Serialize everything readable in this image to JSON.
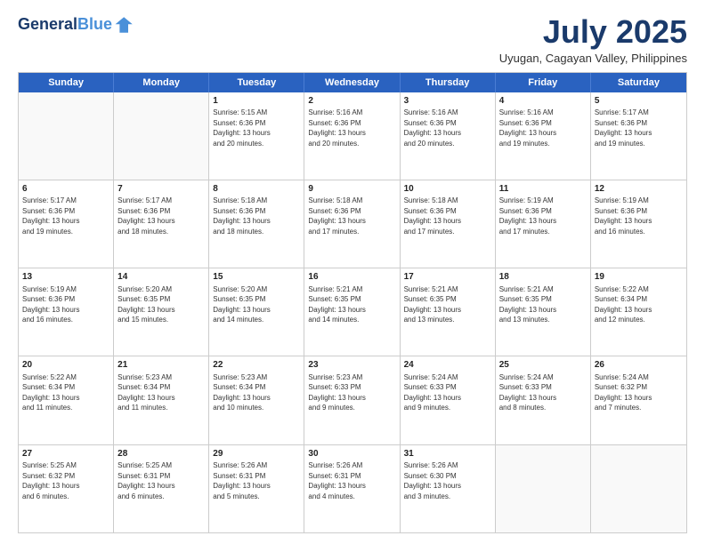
{
  "header": {
    "logo_line1": "General",
    "logo_line2": "Blue",
    "month": "July 2025",
    "location": "Uyugan, Cagayan Valley, Philippines"
  },
  "days_of_week": [
    "Sunday",
    "Monday",
    "Tuesday",
    "Wednesday",
    "Thursday",
    "Friday",
    "Saturday"
  ],
  "weeks": [
    [
      {
        "day": "",
        "info": ""
      },
      {
        "day": "",
        "info": ""
      },
      {
        "day": "1",
        "info": "Sunrise: 5:15 AM\nSunset: 6:36 PM\nDaylight: 13 hours\nand 20 minutes."
      },
      {
        "day": "2",
        "info": "Sunrise: 5:16 AM\nSunset: 6:36 PM\nDaylight: 13 hours\nand 20 minutes."
      },
      {
        "day": "3",
        "info": "Sunrise: 5:16 AM\nSunset: 6:36 PM\nDaylight: 13 hours\nand 20 minutes."
      },
      {
        "day": "4",
        "info": "Sunrise: 5:16 AM\nSunset: 6:36 PM\nDaylight: 13 hours\nand 19 minutes."
      },
      {
        "day": "5",
        "info": "Sunrise: 5:17 AM\nSunset: 6:36 PM\nDaylight: 13 hours\nand 19 minutes."
      }
    ],
    [
      {
        "day": "6",
        "info": "Sunrise: 5:17 AM\nSunset: 6:36 PM\nDaylight: 13 hours\nand 19 minutes."
      },
      {
        "day": "7",
        "info": "Sunrise: 5:17 AM\nSunset: 6:36 PM\nDaylight: 13 hours\nand 18 minutes."
      },
      {
        "day": "8",
        "info": "Sunrise: 5:18 AM\nSunset: 6:36 PM\nDaylight: 13 hours\nand 18 minutes."
      },
      {
        "day": "9",
        "info": "Sunrise: 5:18 AM\nSunset: 6:36 PM\nDaylight: 13 hours\nand 17 minutes."
      },
      {
        "day": "10",
        "info": "Sunrise: 5:18 AM\nSunset: 6:36 PM\nDaylight: 13 hours\nand 17 minutes."
      },
      {
        "day": "11",
        "info": "Sunrise: 5:19 AM\nSunset: 6:36 PM\nDaylight: 13 hours\nand 17 minutes."
      },
      {
        "day": "12",
        "info": "Sunrise: 5:19 AM\nSunset: 6:36 PM\nDaylight: 13 hours\nand 16 minutes."
      }
    ],
    [
      {
        "day": "13",
        "info": "Sunrise: 5:19 AM\nSunset: 6:36 PM\nDaylight: 13 hours\nand 16 minutes."
      },
      {
        "day": "14",
        "info": "Sunrise: 5:20 AM\nSunset: 6:35 PM\nDaylight: 13 hours\nand 15 minutes."
      },
      {
        "day": "15",
        "info": "Sunrise: 5:20 AM\nSunset: 6:35 PM\nDaylight: 13 hours\nand 14 minutes."
      },
      {
        "day": "16",
        "info": "Sunrise: 5:21 AM\nSunset: 6:35 PM\nDaylight: 13 hours\nand 14 minutes."
      },
      {
        "day": "17",
        "info": "Sunrise: 5:21 AM\nSunset: 6:35 PM\nDaylight: 13 hours\nand 13 minutes."
      },
      {
        "day": "18",
        "info": "Sunrise: 5:21 AM\nSunset: 6:35 PM\nDaylight: 13 hours\nand 13 minutes."
      },
      {
        "day": "19",
        "info": "Sunrise: 5:22 AM\nSunset: 6:34 PM\nDaylight: 13 hours\nand 12 minutes."
      }
    ],
    [
      {
        "day": "20",
        "info": "Sunrise: 5:22 AM\nSunset: 6:34 PM\nDaylight: 13 hours\nand 11 minutes."
      },
      {
        "day": "21",
        "info": "Sunrise: 5:23 AM\nSunset: 6:34 PM\nDaylight: 13 hours\nand 11 minutes."
      },
      {
        "day": "22",
        "info": "Sunrise: 5:23 AM\nSunset: 6:34 PM\nDaylight: 13 hours\nand 10 minutes."
      },
      {
        "day": "23",
        "info": "Sunrise: 5:23 AM\nSunset: 6:33 PM\nDaylight: 13 hours\nand 9 minutes."
      },
      {
        "day": "24",
        "info": "Sunrise: 5:24 AM\nSunset: 6:33 PM\nDaylight: 13 hours\nand 9 minutes."
      },
      {
        "day": "25",
        "info": "Sunrise: 5:24 AM\nSunset: 6:33 PM\nDaylight: 13 hours\nand 8 minutes."
      },
      {
        "day": "26",
        "info": "Sunrise: 5:24 AM\nSunset: 6:32 PM\nDaylight: 13 hours\nand 7 minutes."
      }
    ],
    [
      {
        "day": "27",
        "info": "Sunrise: 5:25 AM\nSunset: 6:32 PM\nDaylight: 13 hours\nand 6 minutes."
      },
      {
        "day": "28",
        "info": "Sunrise: 5:25 AM\nSunset: 6:31 PM\nDaylight: 13 hours\nand 6 minutes."
      },
      {
        "day": "29",
        "info": "Sunrise: 5:26 AM\nSunset: 6:31 PM\nDaylight: 13 hours\nand 5 minutes."
      },
      {
        "day": "30",
        "info": "Sunrise: 5:26 AM\nSunset: 6:31 PM\nDaylight: 13 hours\nand 4 minutes."
      },
      {
        "day": "31",
        "info": "Sunrise: 5:26 AM\nSunset: 6:30 PM\nDaylight: 13 hours\nand 3 minutes."
      },
      {
        "day": "",
        "info": ""
      },
      {
        "day": "",
        "info": ""
      }
    ]
  ]
}
